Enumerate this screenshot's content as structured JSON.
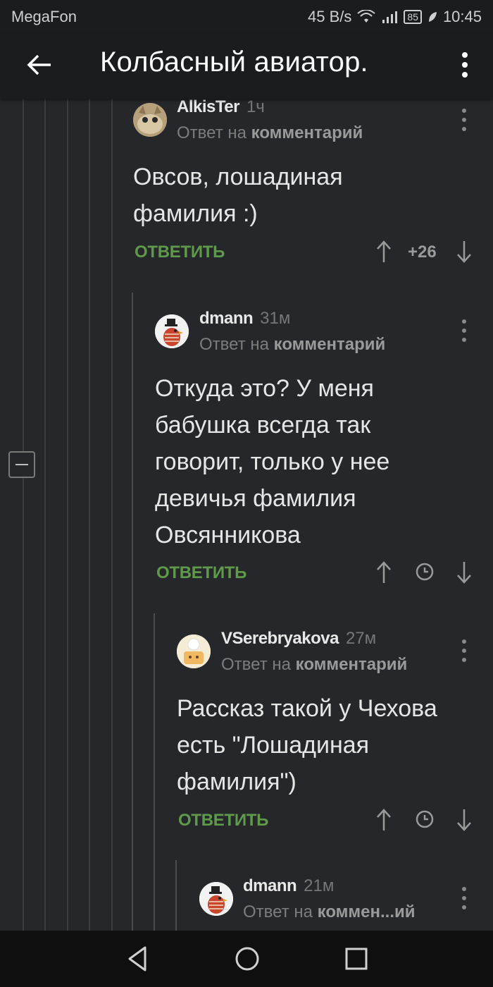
{
  "status": {
    "carrier": "MegaFon",
    "speed": "45 B/s",
    "battery": "85",
    "time": "10:45"
  },
  "appbar": {
    "title": "Колбасный авиатор."
  },
  "comments": [
    {
      "author": "AlkisTer",
      "time": "1ч",
      "reply_prefix": "Ответ на",
      "reply_target": "комментарий",
      "lines": [
        "Овсов, лошадиная",
        "фамилия :)"
      ],
      "reply_label": "ОТВЕТИТЬ",
      "score": "+26"
    },
    {
      "author": "dmann",
      "time": "31м",
      "reply_prefix": "Ответ на",
      "reply_target": "комментарий",
      "lines": [
        "Откуда это? У меня",
        "бабушка всегда так",
        "говорит, только у нее",
        "девичья фамилия",
        "Овсянникова"
      ],
      "reply_label": "ОТВЕТИТЬ"
    },
    {
      "author": "VSerebryakova",
      "time": "27м",
      "reply_prefix": "Ответ на",
      "reply_target": "комментарий",
      "lines": [
        "Рассказ такой у Чехова",
        "есть \"Лошадиная",
        "фамилия\")"
      ],
      "reply_label": "ОТВЕТИТЬ"
    },
    {
      "author": "dmann",
      "time": "21м",
      "reply_prefix": "Ответ на",
      "reply_target": "коммен...ий"
    }
  ],
  "colors": {
    "background": "#25272a",
    "bar": "#1b1c1e",
    "accent_green": "#5f9a4a"
  }
}
